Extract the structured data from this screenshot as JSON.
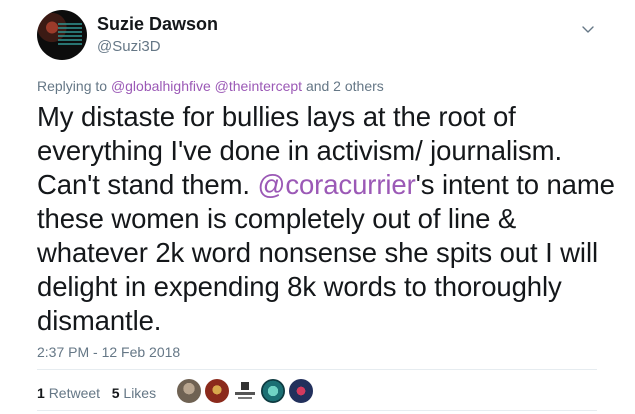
{
  "author": {
    "name": "Suzie Dawson",
    "handle": "@Suzi3D"
  },
  "reply": {
    "prefix": "Replying to",
    "mention_1": "@globalhighfive",
    "mention_2": "@theintercept",
    "suffix": "and 2 others"
  },
  "tweet": {
    "part_1": "My distaste for bullies lays at the root of everything I've done in activism/ journalism. Can't stand them. ",
    "mention": "@coracurrier",
    "part_2": "'s intent to name these women is completely out of line & whatever 2k word nonsense she spits out I will delight in expending 8k words to thoroughly dismantle."
  },
  "timestamp": "2:37 PM - 12 Feb 2018",
  "stats": {
    "retweets_count": "1",
    "retweets_label": "Retweet",
    "likes_count": "5",
    "likes_label": "Likes"
  },
  "colors": {
    "link": "#9b59b6",
    "secondary_text": "#657786",
    "divider": "#e6ecf0"
  }
}
